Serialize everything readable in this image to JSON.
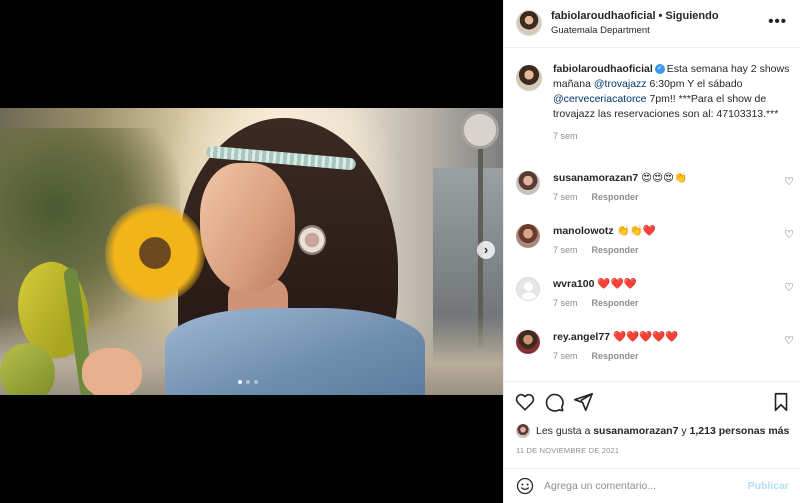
{
  "post": {
    "username": "fabiolaroudhaoficial",
    "follow_status": "Siguiendo",
    "location": "Guatemala Department",
    "more_icon": "more-horizontal-icon"
  },
  "caption": {
    "username": "fabiolaroudhaoficial",
    "text_1": "Esta semana hay 2 shows mañana ",
    "mention_1": "@trovajazz",
    "text_2": " 6:30pm Y el sábado ",
    "mention_2": "@cerveceriacatorce",
    "text_3": " 7pm!! ***Para el show de trovajazz las reservaciones son al: 47103313.***",
    "time": "7 sem"
  },
  "comments": [
    {
      "username": "susanamorazan7",
      "text": "😍😍😍👏",
      "time": "7 sem",
      "reply": "Responder"
    },
    {
      "username": "manolowotz",
      "text": "👏👏❤️",
      "time": "7 sem",
      "reply": "Responder"
    },
    {
      "username": "wvra100",
      "text": "❤️❤️❤️",
      "time": "7 sem",
      "reply": "Responder"
    },
    {
      "username": "rey.angel77",
      "text": "❤️❤️❤️❤️❤️",
      "time": "7 sem",
      "reply": "Responder"
    }
  ],
  "likes": {
    "prefix": "Les gusta a",
    "user": "susanamorazan7",
    "conj": "y",
    "count": "1,213 personas más"
  },
  "date": "11 DE NOVIEMBRE DE 2021",
  "add_comment": {
    "placeholder": "Agrega un comentario...",
    "publish": "Publicar"
  },
  "colors": {
    "mention": "#00376b",
    "verified": "#3897f0",
    "publish_disabled": "#b2dffc",
    "muted": "#8e8e8e"
  },
  "carousel": {
    "slides": 3,
    "active_index": 0
  }
}
